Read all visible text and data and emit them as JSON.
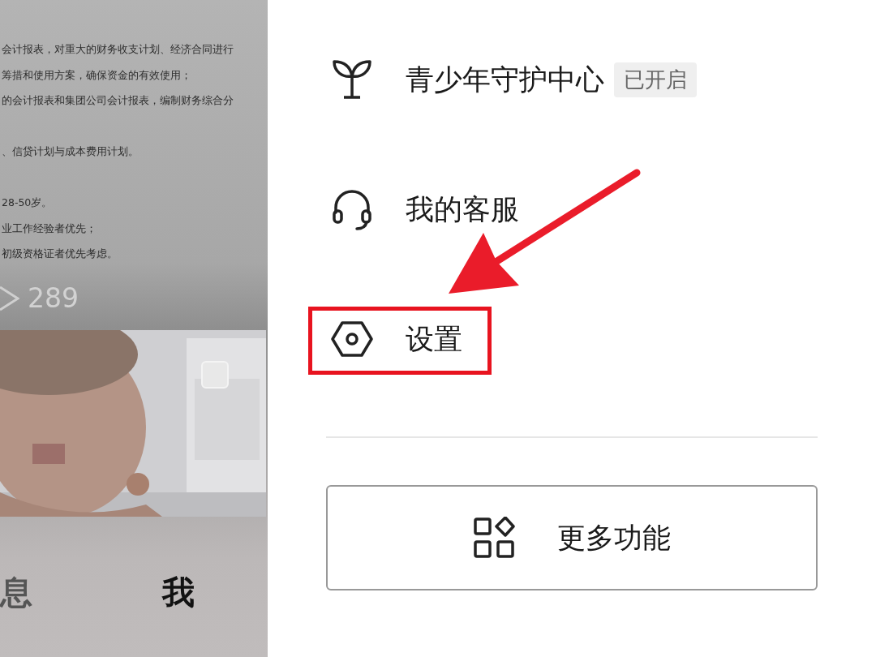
{
  "feed": {
    "paragraphs": [
      [
        "会计报表，对重大的财务收支计划、经济合同进行",
        "筹措和使用方案，确保资金的有效使用；",
        "的会计报表和集团公司会计报表，编制财务综合分"
      ],
      [
        "、信贷计划与成本费用计划。"
      ],
      [
        "28-50岁。",
        "业工作经验者优先；",
        "初级资格证者优先考虑。"
      ]
    ],
    "count": "289",
    "photo": {
      "kind": "picture"
    }
  },
  "bottom_nav": [
    {
      "label": "息",
      "selected": false
    },
    {
      "label": "我",
      "selected": true
    }
  ],
  "menu": [
    {
      "kind": "sprout",
      "label": "青少年守护中心",
      "badge": "已开启",
      "highlighted": false
    },
    {
      "kind": "headset",
      "label": "我的客服",
      "highlighted": false
    },
    {
      "kind": "settings",
      "label": "设置",
      "highlighted": true
    }
  ],
  "more_button": {
    "label": "更多功能"
  }
}
